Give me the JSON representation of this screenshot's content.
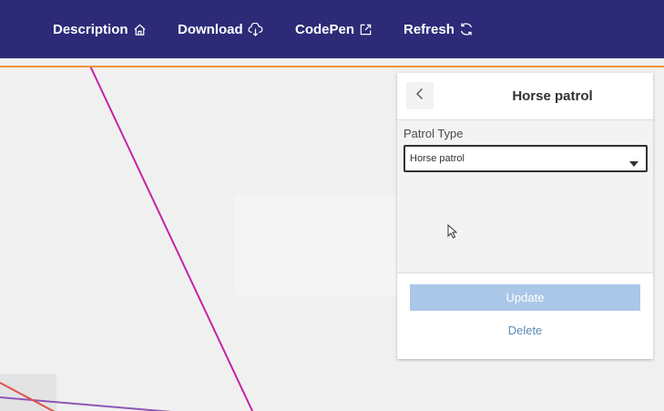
{
  "nav": {
    "items": [
      {
        "label": "Description",
        "icon": "home-icon"
      },
      {
        "label": "Download",
        "icon": "cloud-download-icon"
      },
      {
        "label": "CodePen",
        "icon": "external-link-icon"
      },
      {
        "label": "Refresh",
        "icon": "refresh-icon"
      }
    ]
  },
  "colors": {
    "navbar": "#2d2a78",
    "accent_line": "#f0923a",
    "map_background": "#f0f0f0",
    "line_magenta": "#c622a8",
    "line_purple": "#8e56b8",
    "line_red": "#e0504a",
    "button_disabled": "#abc7e8",
    "link": "#5b8bb5"
  },
  "panel": {
    "title": "Horse patrol",
    "field_label": "Patrol Type",
    "select_value": "Horse patrol",
    "update_label": "Update",
    "delete_label": "Delete"
  }
}
